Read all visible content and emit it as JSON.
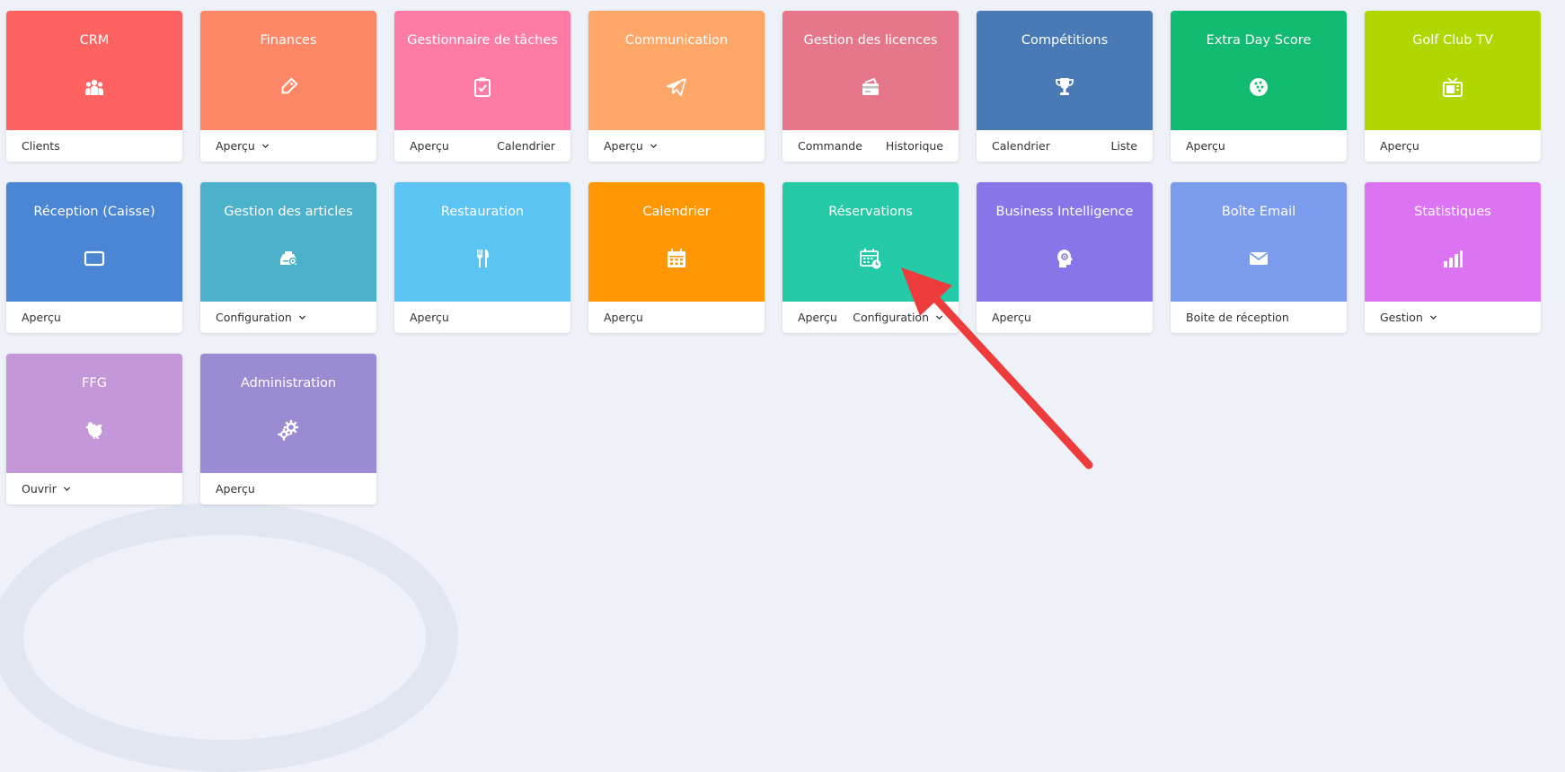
{
  "tiles": [
    {
      "id": "crm",
      "title": "CRM",
      "color": "#fe6261",
      "icon": "users-icon",
      "links": [
        {
          "label": "Clients"
        }
      ]
    },
    {
      "id": "finances",
      "title": "Finances",
      "color": "#fe8768",
      "icon": "tag-icon",
      "links": [
        {
          "label": "Aperçu",
          "dropdown": true
        }
      ]
    },
    {
      "id": "taches",
      "title": "Gestionnaire de tâches",
      "color": "#fe7ba6",
      "icon": "clipboard-check-icon",
      "links": [
        {
          "label": "Aperçu"
        },
        {
          "label": "Calendrier"
        }
      ]
    },
    {
      "id": "communication",
      "title": "Communication",
      "color": "#fea768",
      "icon": "paper-plane-icon",
      "links": [
        {
          "label": "Aperçu",
          "dropdown": true
        }
      ]
    },
    {
      "id": "licences",
      "title": "Gestion des licences",
      "color": "#e6778b",
      "icon": "card-icon",
      "links": [
        {
          "label": "Commande"
        },
        {
          "label": "Historique"
        }
      ]
    },
    {
      "id": "competitions",
      "title": "Compétitions",
      "color": "#4a7ab5",
      "icon": "trophy-icon",
      "links": [
        {
          "label": "Calendrier"
        },
        {
          "label": "Liste"
        }
      ]
    },
    {
      "id": "extraday",
      "title": "Extra Day Score",
      "color": "#11bb72",
      "icon": "golf-ball-icon",
      "links": [
        {
          "label": "Aperçu"
        }
      ]
    },
    {
      "id": "golftv",
      "title": "Golf Club TV",
      "color": "#b0d702",
      "icon": "tv-icon",
      "links": [
        {
          "label": "Aperçu"
        }
      ]
    },
    {
      "id": "reception",
      "title": "Réception (Caisse)",
      "color": "#4b86d5",
      "icon": "tablet-icon",
      "links": [
        {
          "label": "Aperçu"
        }
      ]
    },
    {
      "id": "articles",
      "title": "Gestion des articles",
      "color": "#4cb1cb",
      "icon": "cash-register-icon",
      "links": [
        {
          "label": "Configuration",
          "dropdown": true
        }
      ]
    },
    {
      "id": "restauration",
      "title": "Restauration",
      "color": "#5bc4f2",
      "icon": "fork-knife-icon",
      "links": [
        {
          "label": "Aperçu"
        }
      ]
    },
    {
      "id": "calendrier",
      "title": "Calendrier",
      "color": "#ff9704",
      "icon": "calendar-icon",
      "links": [
        {
          "label": "Aperçu"
        }
      ]
    },
    {
      "id": "reservations",
      "title": "Réservations",
      "color": "#24caa5",
      "icon": "calendar-clock-icon",
      "links": [
        {
          "label": "Aperçu"
        },
        {
          "label": "Configuration",
          "dropdown": true
        }
      ]
    },
    {
      "id": "bi",
      "title": "Business Intelligence",
      "color": "#8875e8",
      "icon": "head-gear-icon",
      "links": [
        {
          "label": "Aperçu"
        }
      ]
    },
    {
      "id": "email",
      "title": "Boîte Email",
      "color": "#7b9cec",
      "icon": "envelope-icon",
      "links": [
        {
          "label": "Boite de réception"
        }
      ]
    },
    {
      "id": "stats",
      "title": "Statistiques",
      "color": "#db73f3",
      "icon": "bar-chart-icon",
      "links": [
        {
          "label": "Gestion",
          "dropdown": true
        }
      ]
    },
    {
      "id": "ffg",
      "title": "FFG",
      "color": "#c497d8",
      "icon": "rooster-icon",
      "links": [
        {
          "label": "Ouvrir",
          "dropdown": true
        }
      ]
    },
    {
      "id": "admin",
      "title": "Administration",
      "color": "#9b8bd3",
      "icon": "gears-icon",
      "links": [
        {
          "label": "Aperçu"
        }
      ]
    }
  ],
  "annotation": {
    "color": "#ee3b3b",
    "points_to": "reservations"
  }
}
